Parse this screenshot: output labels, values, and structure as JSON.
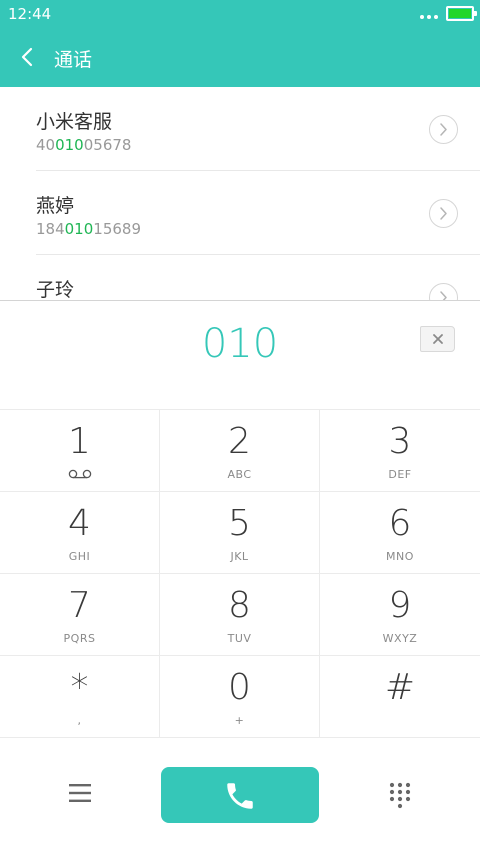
{
  "status_bar": {
    "time": "12:44",
    "battery_color": "#22d62a",
    "icons": [
      "more-dots-icon",
      "battery-icon"
    ]
  },
  "header": {
    "title": "通话",
    "back_icon": "chevron-left-icon",
    "background": "#35c7b8"
  },
  "results": [
    {
      "name": "小米客服",
      "number_prefix": "40",
      "number_match": "010",
      "number_suffix": "05678",
      "action_icon": "chevron-right-circle-icon"
    },
    {
      "name": "燕婷",
      "number_prefix": "184",
      "number_match": "010",
      "number_suffix": "15689",
      "action_icon": "chevron-right-circle-icon"
    },
    {
      "name": "子玲",
      "number_prefix": "",
      "number_match": "",
      "number_suffix": "",
      "action_icon": "chevron-right-circle-icon"
    }
  ],
  "match_color": "#1fb554",
  "dialed": {
    "number": "010",
    "delete_icon": "backspace-icon"
  },
  "keypad": [
    {
      "digit": "1",
      "letters": "",
      "sub_icon": "voicemail-icon"
    },
    {
      "digit": "2",
      "letters": "ABC"
    },
    {
      "digit": "3",
      "letters": "DEF"
    },
    {
      "digit": "4",
      "letters": "GHI"
    },
    {
      "digit": "5",
      "letters": "JKL"
    },
    {
      "digit": "6",
      "letters": "MNO"
    },
    {
      "digit": "7",
      "letters": "PQRS"
    },
    {
      "digit": "8",
      "letters": "TUV"
    },
    {
      "digit": "9",
      "letters": "WXYZ"
    },
    {
      "digit": "*",
      "letters": ","
    },
    {
      "digit": "0",
      "letters": "+"
    },
    {
      "digit": "#",
      "letters": ""
    }
  ],
  "bottom_bar": {
    "menu_icon": "menu-icon",
    "call_icon": "phone-icon",
    "dialpad_icon": "dialpad-icon",
    "call_color": "#35c7b8"
  }
}
